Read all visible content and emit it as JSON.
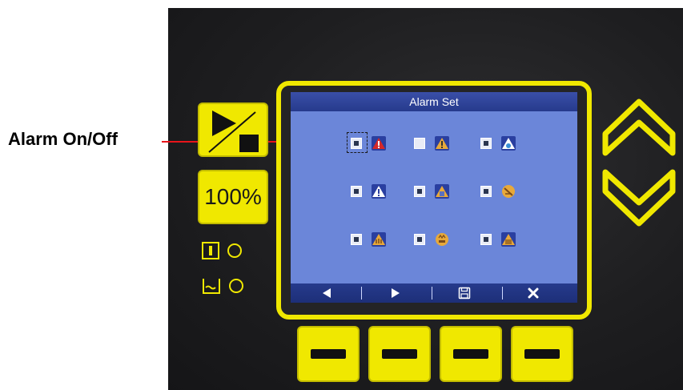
{
  "annotation": {
    "label": "Alarm On/Off",
    "arrow_color": "#e8141a"
  },
  "controls": {
    "hundred_label": "100%",
    "accent_color": "#f0e800"
  },
  "screen": {
    "title": "Alarm Set",
    "background_color": "#6b86d9",
    "titlebar_color": "#263a8c",
    "alarms": [
      {
        "checked": true,
        "icon": "warning-red-icon",
        "focused": true
      },
      {
        "checked": false,
        "icon": "warning-yellow-icon"
      },
      {
        "checked": true,
        "icon": "droplet-icon"
      },
      {
        "checked": true,
        "icon": "warning-white-icon"
      },
      {
        "checked": true,
        "icon": "drain-icon"
      },
      {
        "checked": true,
        "icon": "no-ring-icon"
      },
      {
        "checked": true,
        "icon": "heater-icon"
      },
      {
        "checked": true,
        "icon": "motor-icon"
      },
      {
        "checked": true,
        "icon": "level-icon"
      }
    ],
    "bottom_bar": [
      "prev-icon",
      "next-icon",
      "save-icon",
      "close-icon"
    ]
  }
}
